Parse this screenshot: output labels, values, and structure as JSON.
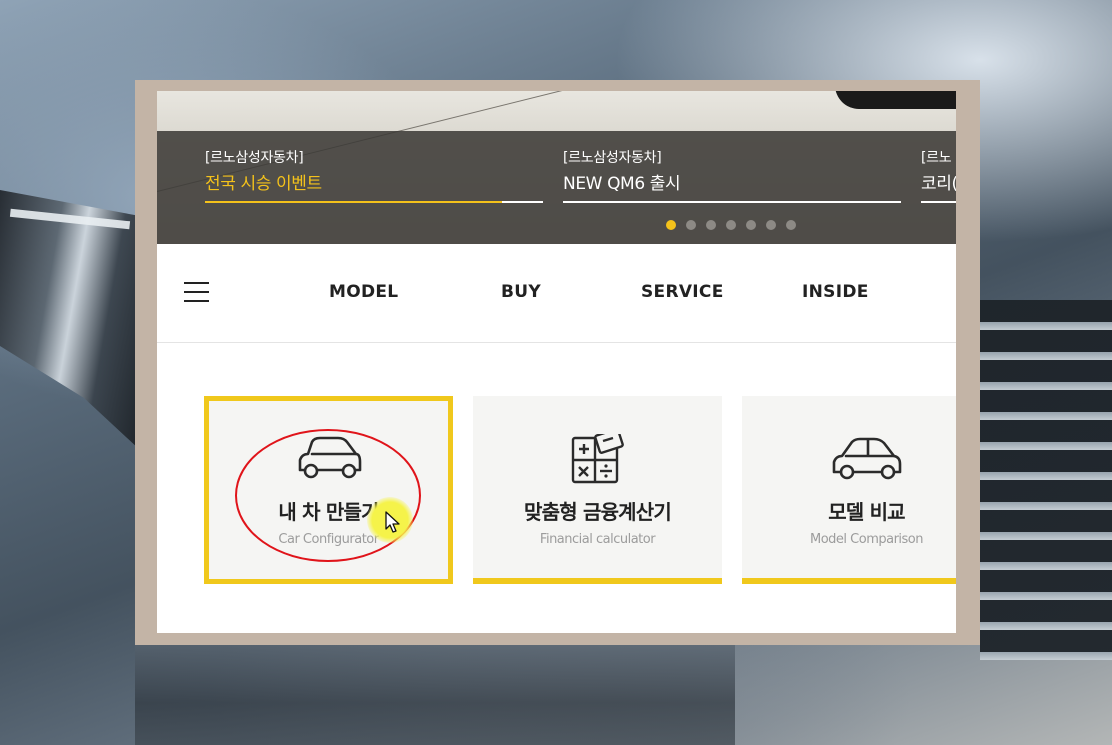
{
  "hero": {
    "slides": [
      {
        "brand": "[르노삼성자동차]",
        "headline": "전국 시승 이벤트",
        "active": true
      },
      {
        "brand": "[르노삼성자동차]",
        "headline": "NEW QM6 출시",
        "active": false
      },
      {
        "brand": "[르노",
        "headline": "코리(",
        "active": false
      }
    ],
    "dot_count": 7,
    "active_dot": 0
  },
  "nav": {
    "menu_icon": "hamburger-icon",
    "items": [
      "MODEL",
      "BUY",
      "SERVICE",
      "INSIDE"
    ]
  },
  "cards": [
    {
      "title": "내 차 만들기",
      "subtitle": "Car Configurator",
      "icon": "car-icon",
      "selected": true
    },
    {
      "title": "맞춤형 금융계산기",
      "subtitle": "Financial calculator",
      "icon": "calculator-icon",
      "selected": false
    },
    {
      "title": "모델 비교",
      "subtitle": "Model Comparison",
      "icon": "car-icon",
      "selected": false
    }
  ],
  "colors": {
    "accent": "#f0c81c",
    "active_headline": "#f4c21b",
    "annotation": "#e0141a",
    "frame": "#c3b4a6"
  }
}
